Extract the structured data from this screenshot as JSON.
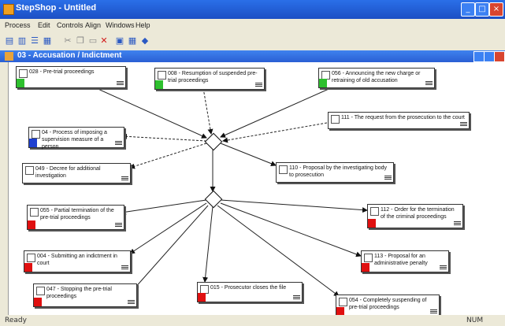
{
  "window": {
    "title": "StepShop - Untitled"
  },
  "menu": [
    "Process",
    "Edit",
    "Controls",
    "Align",
    "Windows",
    "Help"
  ],
  "subwindow": {
    "title": "03 - Accusation / Indictment"
  },
  "status": {
    "left": "Ready",
    "right": "NUM"
  },
  "nodes": [
    {
      "id": "n028",
      "label": "028 - Pre-trial proceedings",
      "color": "green"
    },
    {
      "id": "n008",
      "label": "008 - Resumption of suspended pre-trial proceedings",
      "color": "green"
    },
    {
      "id": "n056",
      "label": "056 - Announcing the new charge or retraining of old accusation",
      "color": "green"
    },
    {
      "id": "n111",
      "label": "111 - The request from the prosecution to the court",
      "color": "blue"
    },
    {
      "id": "n04",
      "label": "04 - Process of imposing a supervision measure of a person",
      "color": "blue"
    },
    {
      "id": "n049",
      "label": "049 - Decree for additional investigation",
      "color": "blue"
    },
    {
      "id": "n110",
      "label": "110 - Proposal by the investigating body to prosecution",
      "color": "blue"
    },
    {
      "id": "n055",
      "label": "055 - Partial termination of the pre-trial proceedings",
      "color": "red"
    },
    {
      "id": "n112",
      "label": "112 - Order for the termination of the criminal proceedings",
      "color": "red"
    },
    {
      "id": "n004",
      "label": "004 - Submitting an indictment in court",
      "color": "red"
    },
    {
      "id": "n113",
      "label": "113 - Proposal for an administrative penalty",
      "color": "red"
    },
    {
      "id": "n047",
      "label": "047 - Stopping the pre-trial proceedings",
      "color": "red"
    },
    {
      "id": "n015",
      "label": "015 - Prosecutor closes the file",
      "color": "red"
    },
    {
      "id": "n054",
      "label": "054 - Completely suspending of pre-trial proceedings",
      "color": "red"
    }
  ]
}
